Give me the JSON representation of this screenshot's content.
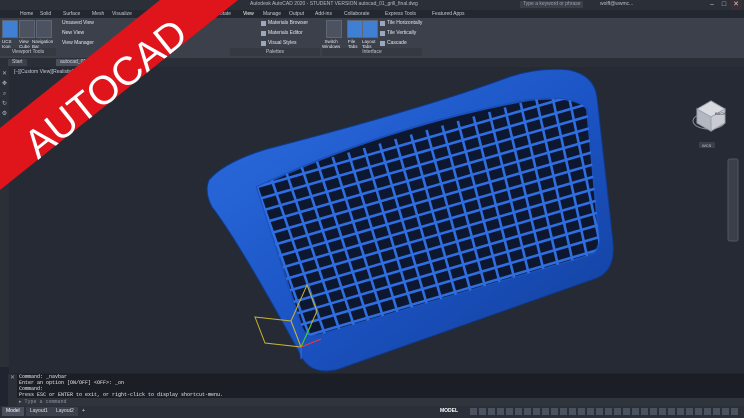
{
  "titlebar": {
    "title": "Autodesk AutoCAD 2020 - STUDENT VERSION    autocad_01_grill_final.dwg",
    "search_placeholder": "Type a keyword or phrase",
    "user": "wolff@wwmc...",
    "minimize": "–",
    "maximize": "□",
    "close": "✕"
  },
  "tabs": [
    "Home",
    "Solid",
    "Surface",
    "Mesh",
    "Visualize",
    "Parametric",
    "Insert",
    "Annotate",
    "View",
    "Manage",
    "Output",
    "Add-ins",
    "Collaborate",
    "Express Tools",
    "Featured Apps"
  ],
  "active_tab": "View",
  "ribbon": {
    "ucs_icon": "UCS\nIcon",
    "view_cube": "View\nCube",
    "nav_bar": "Navigation\nBar",
    "unsaved_view": "Unsaved View",
    "new_view": "New View",
    "view_manager": "View Manager",
    "materials_browser": "Materials Browser",
    "materials_editor": "Materials Editor",
    "visual_styles": "Visual Styles",
    "switch_windows": "Switch\nWindows",
    "file_tabs": "File\nTabs",
    "layout_tabs": "Layout\nTabs",
    "tile_horizontally": "Tile Horizontally",
    "tile_vertically": "Tile Vertically",
    "cascade": "Cascade",
    "panel_viewport_tools": "Viewport Tools",
    "panel_palettes": "Palettes",
    "panel_interface": "Interface"
  },
  "filetabs": [
    "Start",
    "autocad_01_grill_final*"
  ],
  "viewport": {
    "label": "[–][Custom View][Realistic]",
    "viewcube_label": "BACK",
    "wcs_label": "WCS"
  },
  "command": {
    "history": [
      "Command: _navbar",
      "Enter an option [ON/OFF] <OFF>: _on",
      "Command:",
      "Press ESC or ENTER to exit, or right-click to display shortcut-menu."
    ],
    "placeholder": "Type a command"
  },
  "statusbar": {
    "tabs": [
      "Model",
      "Layout1",
      "Layout2"
    ],
    "active": "Model",
    "add": "+",
    "model_label": "MODEL"
  },
  "banner": {
    "text": "AUTOCAD",
    "color": "#e0141b"
  }
}
